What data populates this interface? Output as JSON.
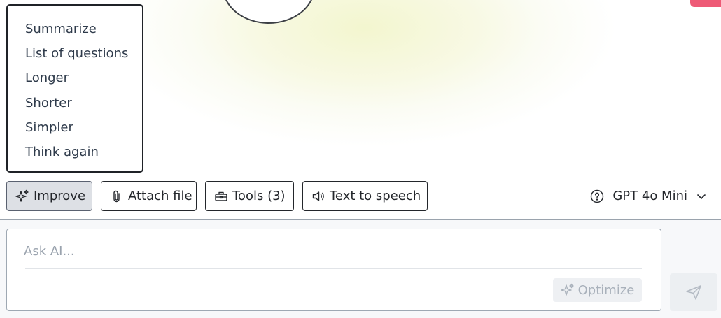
{
  "menu": {
    "items": [
      {
        "label": "Summarize"
      },
      {
        "label": "List of questions"
      },
      {
        "label": "Longer"
      },
      {
        "label": "Shorter"
      },
      {
        "label": "Simpler"
      },
      {
        "label": "Think again"
      }
    ]
  },
  "toolbar": {
    "improve_label": "Improve",
    "attach_label": "Attach file",
    "tools_label": "Tools (3)",
    "tts_label": "Text to speech",
    "model_label": "GPT 4o Mini"
  },
  "input": {
    "placeholder": "Ask AI...",
    "value": "",
    "optimize_label": "Optimize"
  },
  "icons": {
    "improve": "sparkles-icon",
    "attach": "paperclip-icon",
    "tools": "toolbox-icon",
    "tts": "speaker-icon",
    "model_help": "question-circle-icon",
    "model_dropdown": "chevron-down-icon",
    "optimize": "sparkles-icon",
    "send": "paper-plane-icon"
  },
  "colors": {
    "accent": "#ee5a76",
    "active_button_bg": "#dde0e5",
    "disabled_text": "#a9b1bb"
  }
}
